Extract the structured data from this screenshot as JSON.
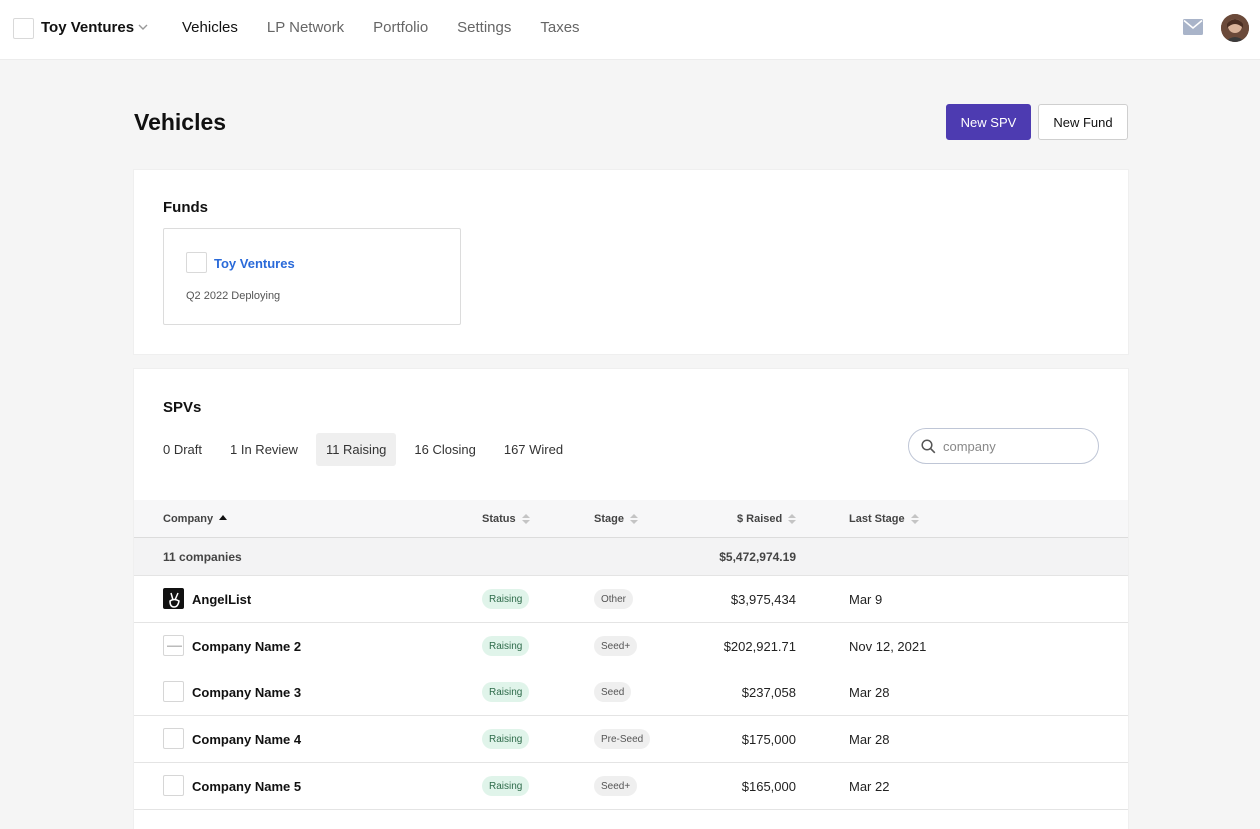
{
  "org": {
    "name": "Toy Ventures"
  },
  "nav": {
    "items": [
      "Vehicles",
      "LP Network",
      "Portfolio",
      "Settings",
      "Taxes"
    ]
  },
  "header": {
    "title": "Vehicles",
    "new_spv_label": "New SPV",
    "new_fund_label": "New Fund"
  },
  "funds": {
    "title": "Funds",
    "items": [
      {
        "name": "Toy Ventures",
        "subtitle": "Q2 2022 Deploying"
      }
    ]
  },
  "spvs": {
    "title": "SPVs",
    "tabs": [
      "0 Draft",
      "1 In Review",
      "11 Raising",
      "16 Closing",
      "167 Wired"
    ],
    "active_tab": "11 Raising",
    "search": {
      "value": "",
      "placeholder": "company"
    },
    "columns": {
      "company": "Company",
      "status": "Status",
      "stage": "Stage",
      "raised": "$ Raised",
      "last_stage": "Last Stage"
    },
    "summary": {
      "count_label": "11 companies",
      "total_raised": "$5,472,974.19"
    },
    "rows": [
      {
        "company": "AngelList",
        "status": "Raising",
        "stage": "Other",
        "raised": "$3,975,434",
        "last_stage": "Mar 9"
      },
      {
        "company": "Company Name 2",
        "status": "Raising",
        "stage": "Seed+",
        "raised": "$202,921.71",
        "last_stage": "Nov 12, 2021"
      },
      {
        "company": "Company Name 3",
        "status": "Raising",
        "stage": "Seed",
        "raised": "$237,058",
        "last_stage": "Mar 28"
      },
      {
        "company": "Company Name 4",
        "status": "Raising",
        "stage": "Pre-Seed",
        "raised": "$175,000",
        "last_stage": "Mar 28"
      },
      {
        "company": "Company Name 5",
        "status": "Raising",
        "stage": "Seed+",
        "raised": "$165,000",
        "last_stage": "Mar 22"
      }
    ]
  },
  "colors": {
    "primary": "#4d3bb1",
    "link": "#2a6ad9",
    "status_bg": "#e0f4ea",
    "status_fg": "#2e6b4a"
  },
  "icons": {
    "org_menu": "chevron-down-icon",
    "mail": "mail-icon",
    "search": "search-icon",
    "sort": "sort-icon"
  }
}
